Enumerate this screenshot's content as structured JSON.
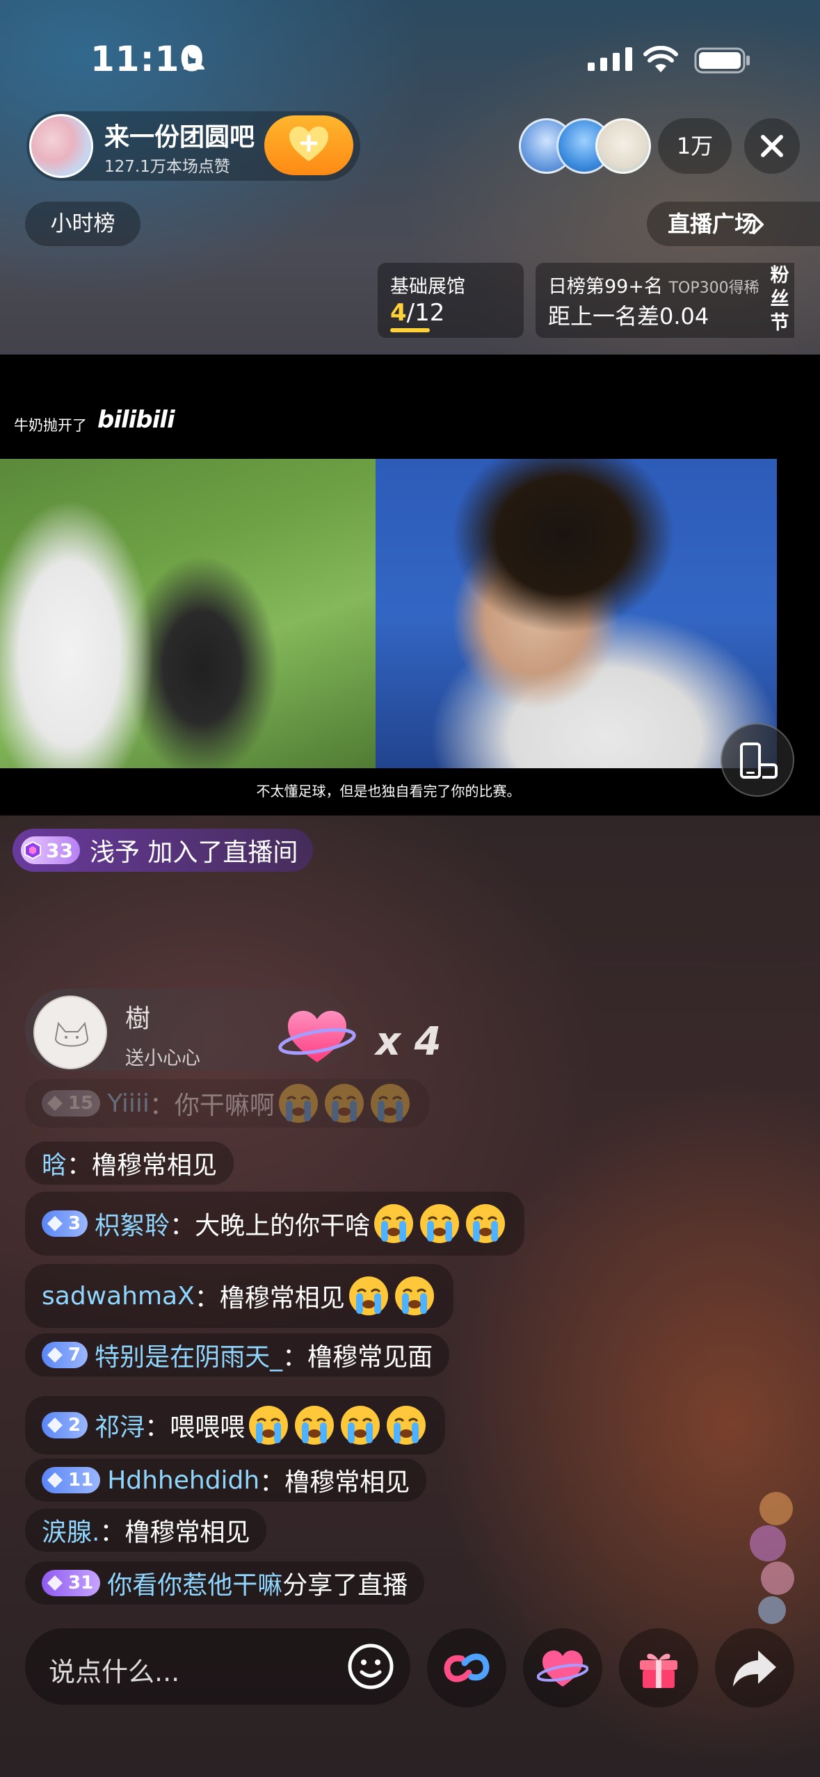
{
  "status": {
    "time": "11:10"
  },
  "host": {
    "name": "来一份团圆吧",
    "likes": "127.1万本场点赞"
  },
  "viewers": {
    "count": "1万"
  },
  "nav": {
    "hourly": "小时榜",
    "plaza": "直播广场"
  },
  "cards": {
    "hall": {
      "title": "基础展馆",
      "current": "4",
      "total": "/12",
      "progress": 0.33
    },
    "rank": {
      "title": "日榜第99+名",
      "sub": "TOP300得稀",
      "diff": "距上一名差0.04"
    },
    "fansday": "粉丝节"
  },
  "video": {
    "top_caption": "牛奶抛开了",
    "logo": "bilibili",
    "subtitle": "不太懂足球，但是也独自看完了你的比赛。"
  },
  "join": {
    "level": "33",
    "text": "浅予 加入了直播间"
  },
  "gift": {
    "user": "樹",
    "desc": "送小心心",
    "count": "x 4"
  },
  "chat": [
    {
      "level": "15",
      "user": "Yiiii",
      "text": "：你干嘛啊",
      "emojis": 3,
      "faded": true
    },
    {
      "level": "",
      "user": "晗",
      "text": "：橹穆常相见",
      "emojis": 0
    },
    {
      "level": "3",
      "user": "枳絮聆",
      "text": "：大晚上的你干啥",
      "emojis": 3
    },
    {
      "level": "",
      "user": "sadwahmaX",
      "text": "：橹穆常相见",
      "emojis": 2
    },
    {
      "level": "7",
      "user": "特别是在阴雨天_",
      "text": "：橹穆常见面",
      "emojis": 0
    },
    {
      "level": "2",
      "user": "祁浔",
      "text": "：喂喂喂",
      "emojis": 4
    },
    {
      "level": "11",
      "user": "Hdhhehdidh",
      "text": "：橹穆常相见",
      "emojis": 0
    },
    {
      "level": "",
      "user": "涙腺.",
      "text": "：橹穆常相见",
      "emojis": 0
    },
    {
      "level": "31",
      "user": "你看你惹他干嘛",
      "text": " 分享了直播",
      "emojis": 0
    }
  ],
  "input": {
    "placeholder": "说点什么..."
  },
  "colors": {
    "accent": "#ff9a1e",
    "username": "#8fd7ff",
    "progress": "#ffd23a"
  },
  "icons": [
    "person-icon",
    "signal-icon",
    "wifi-icon",
    "battery-icon",
    "heart-plus-icon",
    "close-icon",
    "chevron-right-icon",
    "rotate-screen-icon",
    "emoji-icon",
    "link-icon",
    "heart-planet-icon",
    "gift-icon",
    "share-icon"
  ]
}
